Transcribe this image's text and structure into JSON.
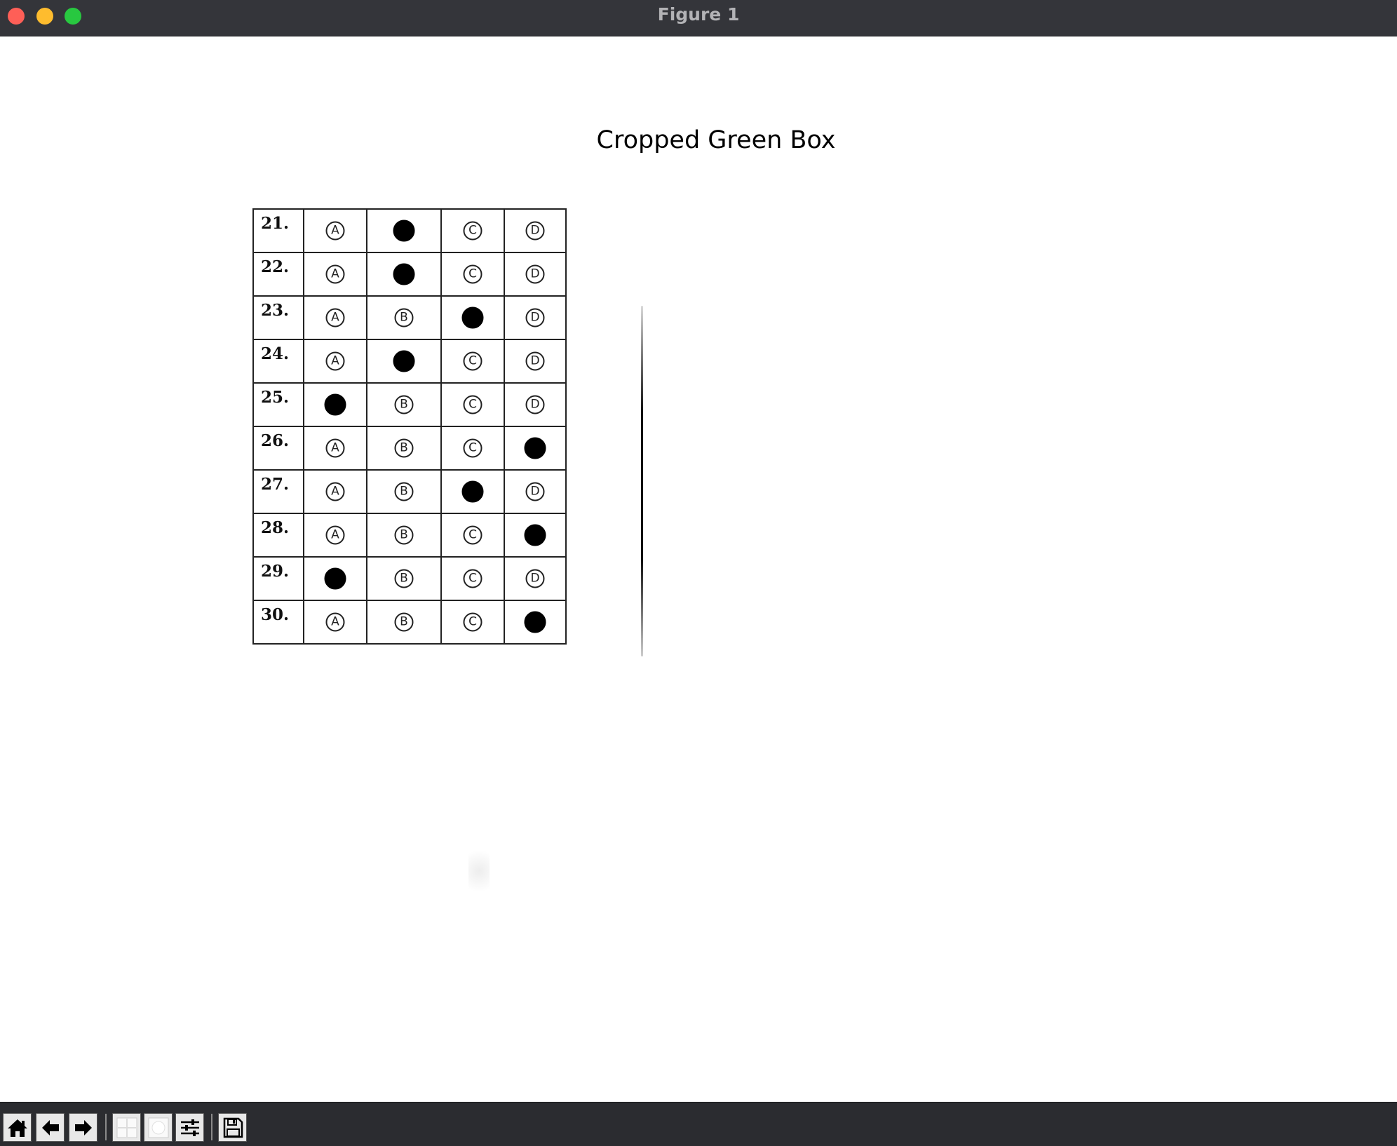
{
  "window": {
    "title": "Figure 1"
  },
  "figure": {
    "title": "Cropped Green Box"
  },
  "answer_sheet": {
    "choices": [
      "A",
      "B",
      "C",
      "D"
    ],
    "rows": [
      {
        "number": "21.",
        "marked": "B"
      },
      {
        "number": "22.",
        "marked": "B"
      },
      {
        "number": "23.",
        "marked": "C"
      },
      {
        "number": "24.",
        "marked": "B"
      },
      {
        "number": "25.",
        "marked": "A"
      },
      {
        "number": "26.",
        "marked": "D"
      },
      {
        "number": "27.",
        "marked": "C"
      },
      {
        "number": "28.",
        "marked": "D"
      },
      {
        "number": "29.",
        "marked": "A"
      },
      {
        "number": "30.",
        "marked": "D"
      }
    ]
  },
  "toolbar": {
    "buttons": [
      {
        "name": "home-button",
        "icon": "home-icon"
      },
      {
        "name": "back-button",
        "icon": "arrow-left-icon"
      },
      {
        "name": "forward-button",
        "icon": "arrow-right-icon"
      },
      {
        "name": "pan-button",
        "icon": "move-icon"
      },
      {
        "name": "zoom-button",
        "icon": "zoom-rect-icon"
      },
      {
        "name": "configure-subplots-button",
        "icon": "sliders-icon"
      },
      {
        "name": "save-button",
        "icon": "floppy-disk-icon"
      }
    ]
  },
  "colors": {
    "titlebar": "#34353a",
    "toolbar": "#2b2c30",
    "close": "#fe5f57",
    "minimize": "#febc2e",
    "maximize": "#28c840"
  }
}
